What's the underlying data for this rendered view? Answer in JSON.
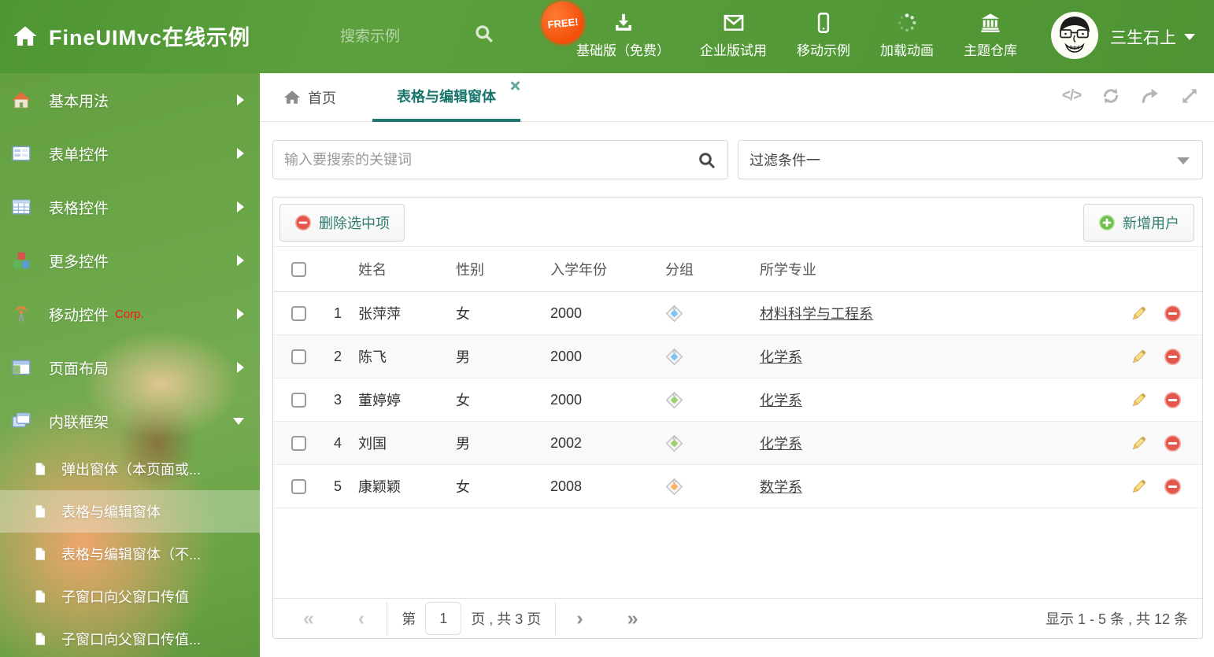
{
  "header": {
    "title": "FineUIMvc在线示例",
    "search_placeholder": "搜索示例",
    "free_badge": "FREE!",
    "nav": [
      {
        "label": "基础版（免费）"
      },
      {
        "label": "企业版试用"
      },
      {
        "label": "移动示例"
      },
      {
        "label": "加载动画"
      },
      {
        "label": "主题仓库"
      }
    ],
    "username": "三生石上"
  },
  "sidebar": {
    "items": [
      {
        "label": "基本用法"
      },
      {
        "label": "表单控件"
      },
      {
        "label": "表格控件"
      },
      {
        "label": "更多控件"
      },
      {
        "label": "移动控件",
        "badge": "Corp."
      },
      {
        "label": "页面布局"
      },
      {
        "label": "内联框架"
      }
    ],
    "subitems": [
      {
        "label": "弹出窗体（本页面或..."
      },
      {
        "label": "表格与编辑窗体"
      },
      {
        "label": "表格与编辑窗体（不..."
      },
      {
        "label": "子窗口向父窗口传值"
      },
      {
        "label": "子窗口向父窗口传值..."
      }
    ]
  },
  "tabs": {
    "home": "首页",
    "active": "表格与编辑窗体"
  },
  "filters": {
    "search_placeholder": "输入要搜索的关键词",
    "filter_value": "过滤条件一"
  },
  "toolbar": {
    "delete_label": "删除选中项",
    "add_label": "新增用户"
  },
  "table": {
    "columns": {
      "name": "姓名",
      "gender": "性别",
      "year": "入学年份",
      "group": "分组",
      "major": "所学专业"
    },
    "rows": [
      {
        "num": "1",
        "name": "张萍萍",
        "gender": "女",
        "year": "2000",
        "tag_color": "#7cc4f4",
        "major": "材料科学与工程系"
      },
      {
        "num": "2",
        "name": "陈飞",
        "gender": "男",
        "year": "2000",
        "tag_color": "#7cc4f4",
        "major": "化学系"
      },
      {
        "num": "3",
        "name": "董婷婷",
        "gender": "女",
        "year": "2000",
        "tag_color": "#9ed06a",
        "major": "化学系"
      },
      {
        "num": "4",
        "name": "刘国",
        "gender": "男",
        "year": "2002",
        "tag_color": "#9ed06a",
        "major": "化学系"
      },
      {
        "num": "5",
        "name": "康颖颖",
        "gender": "女",
        "year": "2008",
        "tag_color": "#ffb15e",
        "major": "数学系"
      }
    ]
  },
  "pagination": {
    "first": "«",
    "prev": "‹",
    "next": "›",
    "last": "»",
    "prefix": "第",
    "page": "1",
    "suffix": "页 , 共 3 页",
    "summary": "显示 1 - 5 条 , 共 12 条"
  },
  "colors": {
    "header_green": "#579c3a",
    "accent_teal": "#17756b",
    "delete_red": "#e4574d",
    "add_green": "#6fbf4f",
    "tag_blue": "#7cc4f4",
    "tag_green": "#9ed06a",
    "tag_orange": "#ffb15e"
  }
}
